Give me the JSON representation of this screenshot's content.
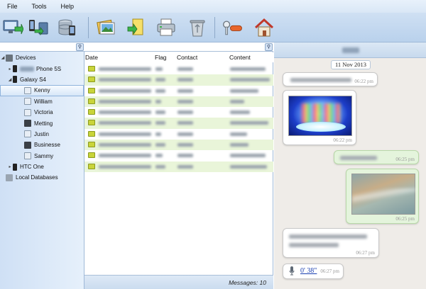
{
  "menu": {
    "file": "File",
    "tools": "Tools",
    "help": "Help"
  },
  "toolbar": {
    "buttons": [
      "export-to-pc-icon",
      "transfer-to-device-icon",
      "backup-database-icon",
      "photos-icon",
      "import-note-icon",
      "print-icon",
      "recycle-bin-icon",
      "register-key-icon",
      "home-icon"
    ]
  },
  "tree": {
    "devices": "Devices",
    "iphone": "Phone 5S",
    "galaxy": "Galaxy S4",
    "contacts": [
      "Kenny",
      "William",
      "Victoria",
      "Metting",
      "Justin",
      "Businesse",
      "Sammy"
    ],
    "htc": "HTC One",
    "local_db": "Local Databases"
  },
  "list": {
    "col_date": "Date",
    "col_flag": "Flag",
    "col_contact": "Contact",
    "col_content": "Content",
    "footer": "Messages: 10"
  },
  "chat": {
    "date": "11 Nov 2013",
    "messages": [
      {
        "time": "06:22 pm",
        "type": "text"
      },
      {
        "time": "06:22 pm",
        "type": "image"
      },
      {
        "time": "06:25 pm",
        "type": "text"
      },
      {
        "time": "06:25 pm",
        "type": "image"
      },
      {
        "time": "06:27 pm",
        "type": "text"
      },
      {
        "time": "06:27 pm",
        "type": "audio",
        "duration": "0' 38\""
      }
    ]
  },
  "colors": {
    "accent": "#3a7bd5",
    "selected_row": "#d6e6f8",
    "alt_row": "#e9f5d9",
    "outgoing": "#e4f4dc"
  }
}
